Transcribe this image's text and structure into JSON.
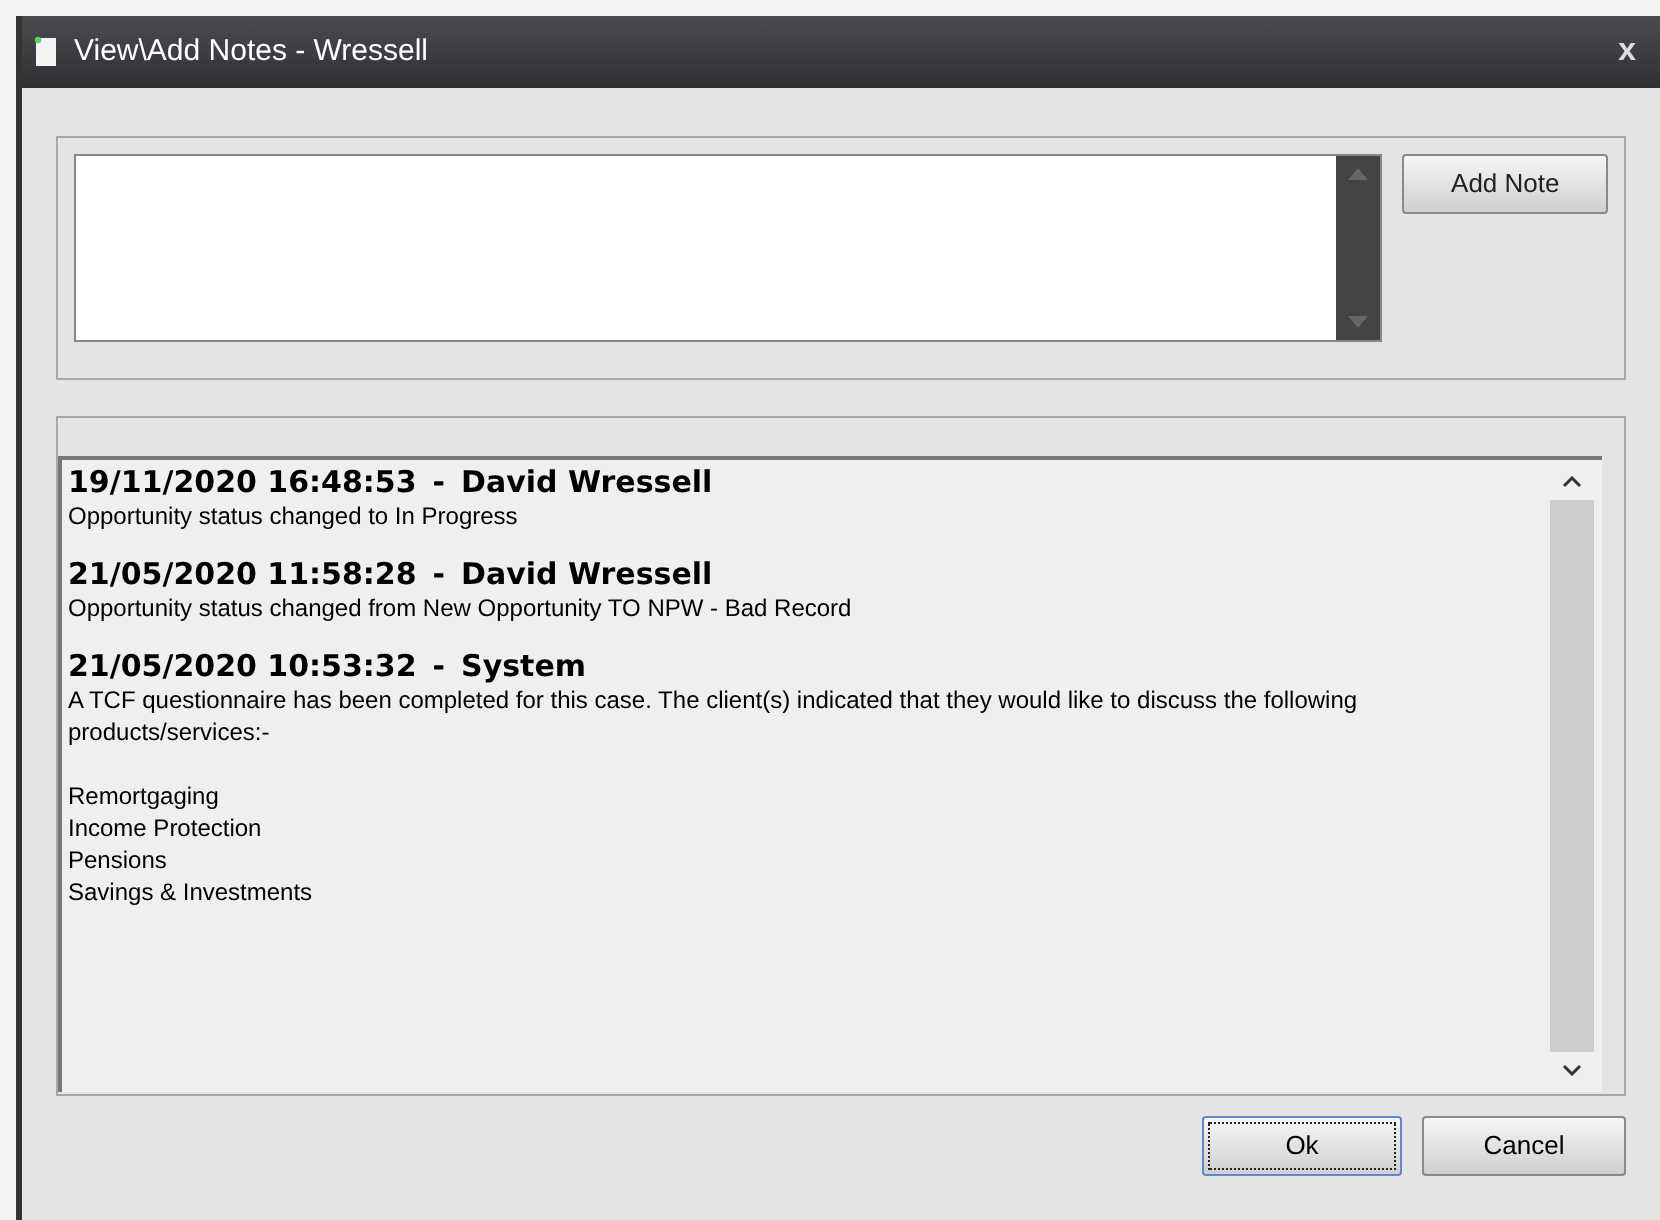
{
  "window": {
    "title": "View\\Add Notes - Wressell",
    "close": "x"
  },
  "add_note_button": "Add Note",
  "notes": [
    {
      "timestamp": "19/11/2020 16:48:53",
      "separator": "-",
      "author": "David Wressell",
      "paragraphs": [
        [
          "Opportunity status changed to In Progress"
        ]
      ]
    },
    {
      "timestamp": "21/05/2020 11:58:28",
      "separator": "-",
      "author": "David Wressell",
      "paragraphs": [
        [
          "Opportunity status changed from New Opportunity TO NPW - Bad Record"
        ]
      ]
    },
    {
      "timestamp": "21/05/2020 10:53:32",
      "separator": "-",
      "author": "System",
      "paragraphs": [
        [
          "A TCF questionnaire has been completed for this case. The client(s) indicated that they would like to discuss the following products/services:-"
        ],
        [
          "Remortgaging",
          "Income Protection",
          "Pensions",
          "Savings & Investments"
        ]
      ]
    }
  ],
  "buttons": [
    {
      "label": "Ok",
      "selected": true
    },
    {
      "label": "Cancel",
      "selected": false
    }
  ]
}
